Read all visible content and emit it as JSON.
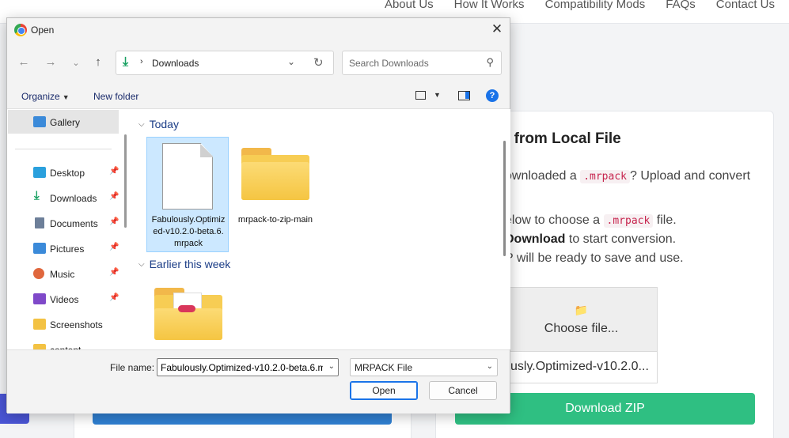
{
  "background_page": {
    "nav_links": [
      "About Us",
      "How It Works",
      "Compatibility Mods",
      "FAQs",
      "Contact Us"
    ],
    "card_title": ": from Local File",
    "line1_pre": "ownloaded a ",
    "line1_code": ".mrpack",
    "line1_post": "? Upload and convert",
    "line2_pre": "elow to choose a ",
    "line2_code": ".mrpack",
    "line2_post": " file.",
    "line3_bold": "Download",
    "line3_post": " to start conversion.",
    "line4": "P will be ready to save and use.",
    "choose_file_label": "Choose file...",
    "chosen_file_name": "usly.Optimized-v10.2.0...",
    "download_zip_label": "Download ZIP"
  },
  "dialog": {
    "title": "Open",
    "address": {
      "separator": "›",
      "path": "Downloads"
    },
    "search": {
      "placeholder": "Search Downloads"
    },
    "toolbar": {
      "organize": "Organize",
      "new_folder": "New folder"
    },
    "sidebar": {
      "gallery": "Gallery",
      "items": [
        {
          "label": "Desktop",
          "icon": "desktop-icon"
        },
        {
          "label": "Downloads",
          "icon": "downloads-icon"
        },
        {
          "label": "Documents",
          "icon": "documents-icon"
        },
        {
          "label": "Pictures",
          "icon": "pictures-icon"
        },
        {
          "label": "Music",
          "icon": "music-icon"
        },
        {
          "label": "Videos",
          "icon": "videos-icon"
        },
        {
          "label": "Screenshots",
          "icon": "folder-icon"
        },
        {
          "label": "content",
          "icon": "folder-icon"
        }
      ]
    },
    "groups": {
      "today": "Today",
      "earlier": "Earlier this week"
    },
    "files": {
      "selected_file": "Fabulously.Optimized-v10.2.0-beta.6.mrpack",
      "folder": "mrpack-to-zip-main"
    },
    "bottom": {
      "file_name_label": "File name:",
      "file_name_value": "Fabulously.Optimized-v10.2.0-beta.6.mrpack",
      "file_type": "MRPACK File",
      "open_label": "Open",
      "cancel_label": "Cancel"
    }
  }
}
